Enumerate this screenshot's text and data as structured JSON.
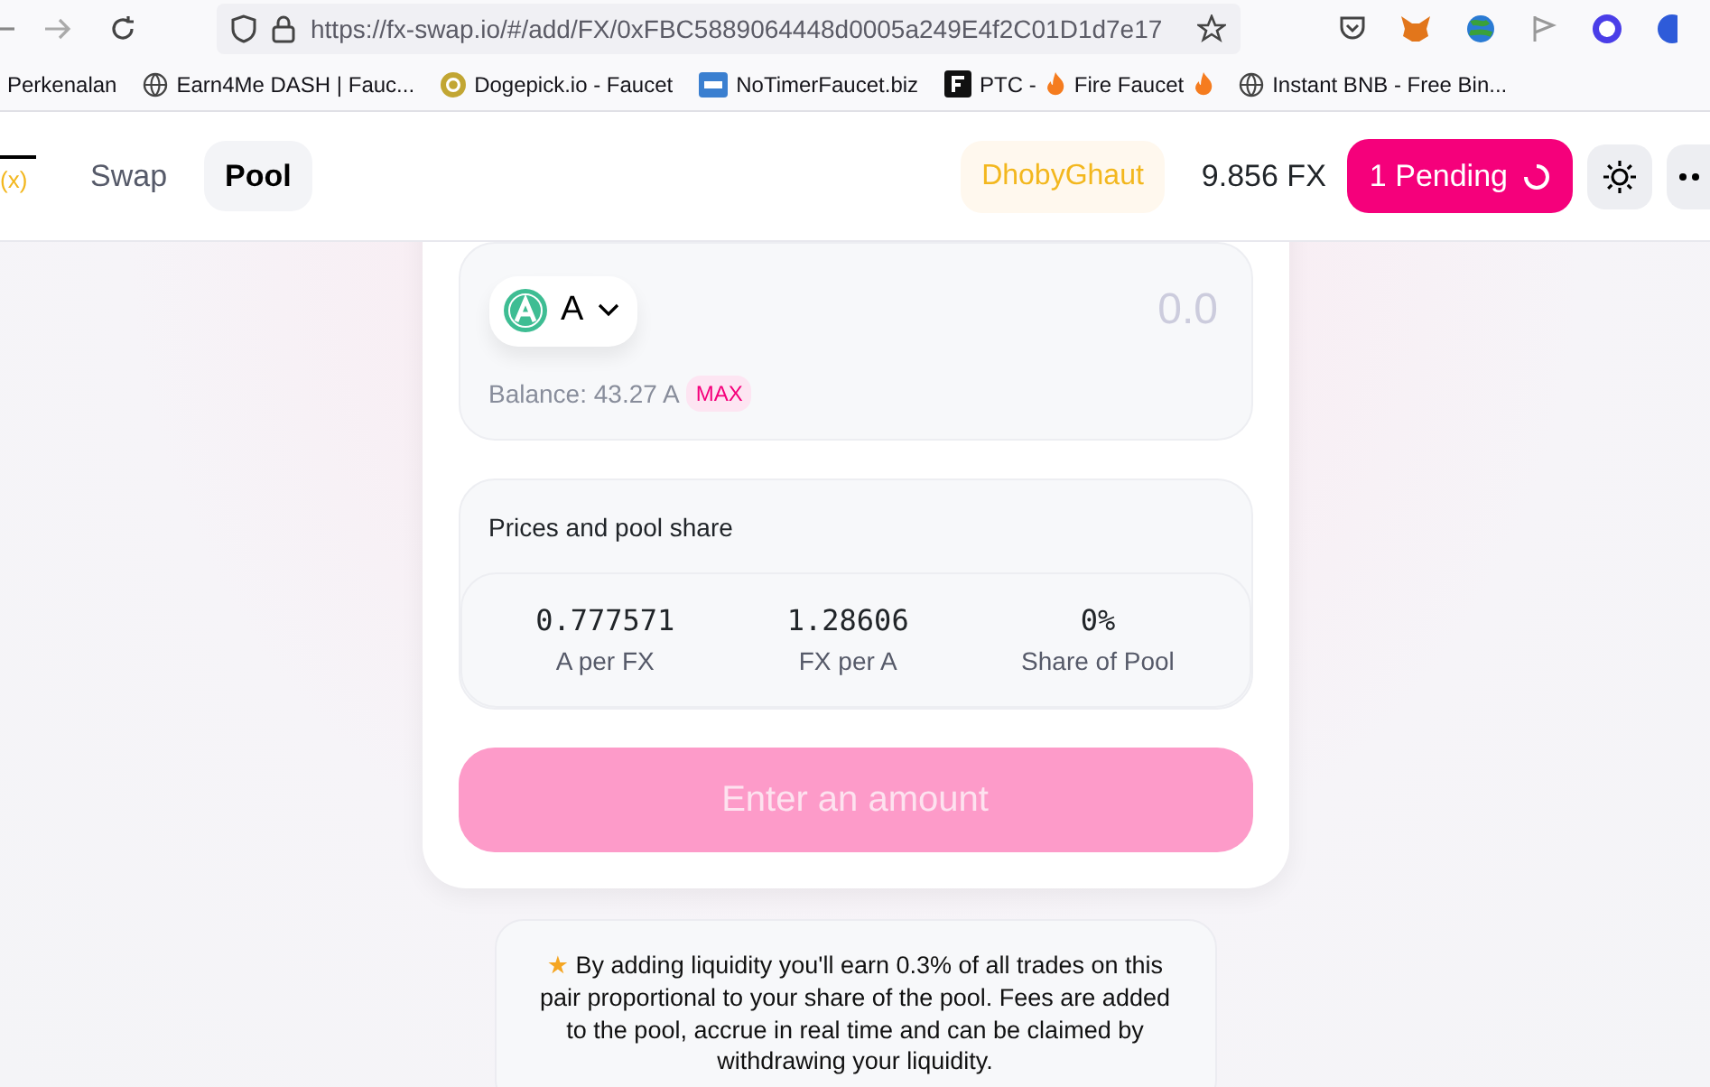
{
  "browser": {
    "url": "https://fx-swap.io/#/add/FX/0xFBC5889064448d0005a249E4f2C01D1d7e17",
    "bookmarks": [
      {
        "kind": "none",
        "parts": [
          "Perkenalan"
        ]
      },
      {
        "kind": "globe",
        "parts": [
          "Earn4Me DASH | Fauc..."
        ]
      },
      {
        "kind": "coin",
        "parts": [
          "Dogepick.io - Faucet"
        ]
      },
      {
        "kind": "free",
        "parts": [
          "NoTimerFaucet.biz"
        ]
      },
      {
        "kind": "fire",
        "parts": [
          "PTC -",
          "Fire Faucet"
        ]
      },
      {
        "kind": "globe",
        "parts": [
          "Instant BNB - Free Bin..."
        ]
      }
    ]
  },
  "header": {
    "logo": "(x)",
    "nav": [
      {
        "label": "Swap",
        "selected": false
      },
      {
        "label": "Pool",
        "selected": true
      }
    ],
    "network": "DhobyGhaut",
    "balance": "9.856 FX",
    "pending": "1 Pending"
  },
  "input": {
    "token": "A",
    "placeholder": "0.0",
    "balance": "Balance: 43.27 A",
    "max": "MAX"
  },
  "prices": {
    "title": "Prices and pool share",
    "items": [
      {
        "value": "0.777571",
        "label": "A per FX"
      },
      {
        "value": "1.28606",
        "label": "FX per A"
      },
      {
        "value": "0%",
        "label": "Share of Pool"
      }
    ]
  },
  "submit": {
    "label": "Enter an amount",
    "disabled": true
  },
  "note": "★ By adding liquidity you'll earn 0.3% of all trades on this pair proportional to your share of the pool. Fees are added to the pool, accrue in real time and can be claimed by withdrawing your liquidity."
}
